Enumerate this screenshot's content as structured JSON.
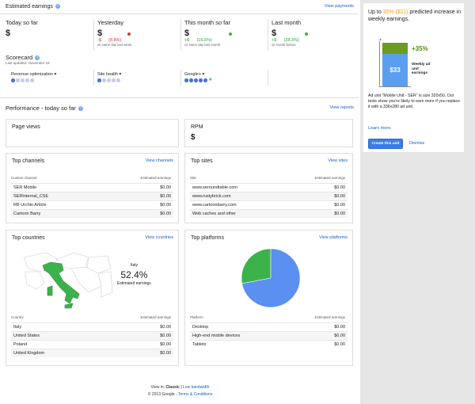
{
  "header": {
    "title": "Estimated earnings",
    "view_payments": "View payments"
  },
  "stats": [
    {
      "title": "Today so far",
      "value": "$",
      "delta": "",
      "note": ""
    },
    {
      "title": "Yesterday",
      "value": "$",
      "delta": "-$      (8.8%)",
      "note": "vs same day last week",
      "trend": "down"
    },
    {
      "title": "This month so far",
      "value": "$",
      "delta": "+$      (16.5%)",
      "note": "vs same day last month",
      "trend": "up"
    },
    {
      "title": "Last month",
      "value": "$",
      "delta": "+$      (28.3%)",
      "note": "vs month before",
      "trend": "up"
    }
  ],
  "scorecard": {
    "title": "Scorecard",
    "updated": "Last updated: November 18",
    "items": [
      {
        "label": "Revenue optimization",
        "filled": 1,
        "total": 5
      },
      {
        "label": "Site health",
        "filled": 1,
        "total": 5
      },
      {
        "label": "Google+",
        "filled": 5,
        "total": 5,
        "star": true
      }
    ]
  },
  "performance": {
    "title": "Performance - today so far",
    "view_reports": "View reports"
  },
  "page_views": {
    "title": "Page views"
  },
  "rpm": {
    "title": "RPM",
    "value": "$"
  },
  "top_channels": {
    "title": "Top channels",
    "link": "View channels",
    "col1": "Custom channel",
    "col2": "Estimated earnings",
    "rows": [
      {
        "name": "SER Mobile",
        "value": "$0.00"
      },
      {
        "name": "SERInternal_CSE",
        "value": "$0.00"
      },
      {
        "name": "RB Urchin Article",
        "value": "$0.00"
      },
      {
        "name": "Cartoon Barry",
        "value": "$0.00"
      }
    ]
  },
  "top_sites": {
    "title": "Top sites",
    "link": "View sites",
    "col1": "Site",
    "col2": "Estimated earnings",
    "rows": [
      {
        "name": "www.seroundtable.com",
        "value": "$0.00"
      },
      {
        "name": "www.rustybrick.com",
        "value": "$0.00"
      },
      {
        "name": "www.cartoonbarry.com",
        "value": "$0.00"
      },
      {
        "name": "Web caches and other",
        "value": "$0.00"
      }
    ]
  },
  "top_countries": {
    "title": "Top countries",
    "link": "View countries",
    "map_country": "Italy",
    "map_percent": "52.4%",
    "map_caption": "Estimated earnings",
    "col1": "Country",
    "col2": "Estimated earnings",
    "rows": [
      {
        "name": "Italy",
        "value": "$0.00"
      },
      {
        "name": "United States",
        "value": "$0.00"
      },
      {
        "name": "Poland",
        "value": "$0.00"
      },
      {
        "name": "United Kingdom",
        "value": "$0.00"
      }
    ]
  },
  "top_platforms": {
    "title": "Top platforms",
    "link": "View platforms",
    "pie": [
      {
        "label": "Desktop",
        "share": 0.72,
        "color": "#5b8ff0"
      },
      {
        "label": "High-end mobile devices",
        "share": 0.28,
        "color": "#3bb34a"
      }
    ],
    "col1": "Platform",
    "col2": "Estimated earnings",
    "rows": [
      {
        "name": "Desktop",
        "value": "$0.00"
      },
      {
        "name": "High-end mobile devices",
        "value": "$0.00"
      },
      {
        "name": "Tablets",
        "value": "$0.00"
      }
    ]
  },
  "promo": {
    "headline_prefix": "Up to ",
    "headline_highlight": "35% ($11)",
    "headline_suffix": " predicted increase in weekly earnings.",
    "bar_base_value": "$33",
    "bar_increase": "+35%",
    "bar_label": "Weekly ad unit earnings",
    "body": "Ad unit \"Mobile Unit - SER\" is size 320x50. Our tests show you're likely to earn more if you replace it with a 336x280 ad unit.",
    "learn_more": "Learn more.",
    "create_button": "Create this unit",
    "dismiss": "Dismiss",
    "colors": {
      "highlight": "#f39c12",
      "base": "#5b9ef0",
      "increase": "#6b9b20"
    }
  },
  "footer": {
    "view_in": "View in:",
    "classic": "Classic",
    "sep": "|",
    "low_bandwidth": "Low bandwidth",
    "copyright": "© 2013 Google -",
    "terms": "Terms & Conditions"
  }
}
